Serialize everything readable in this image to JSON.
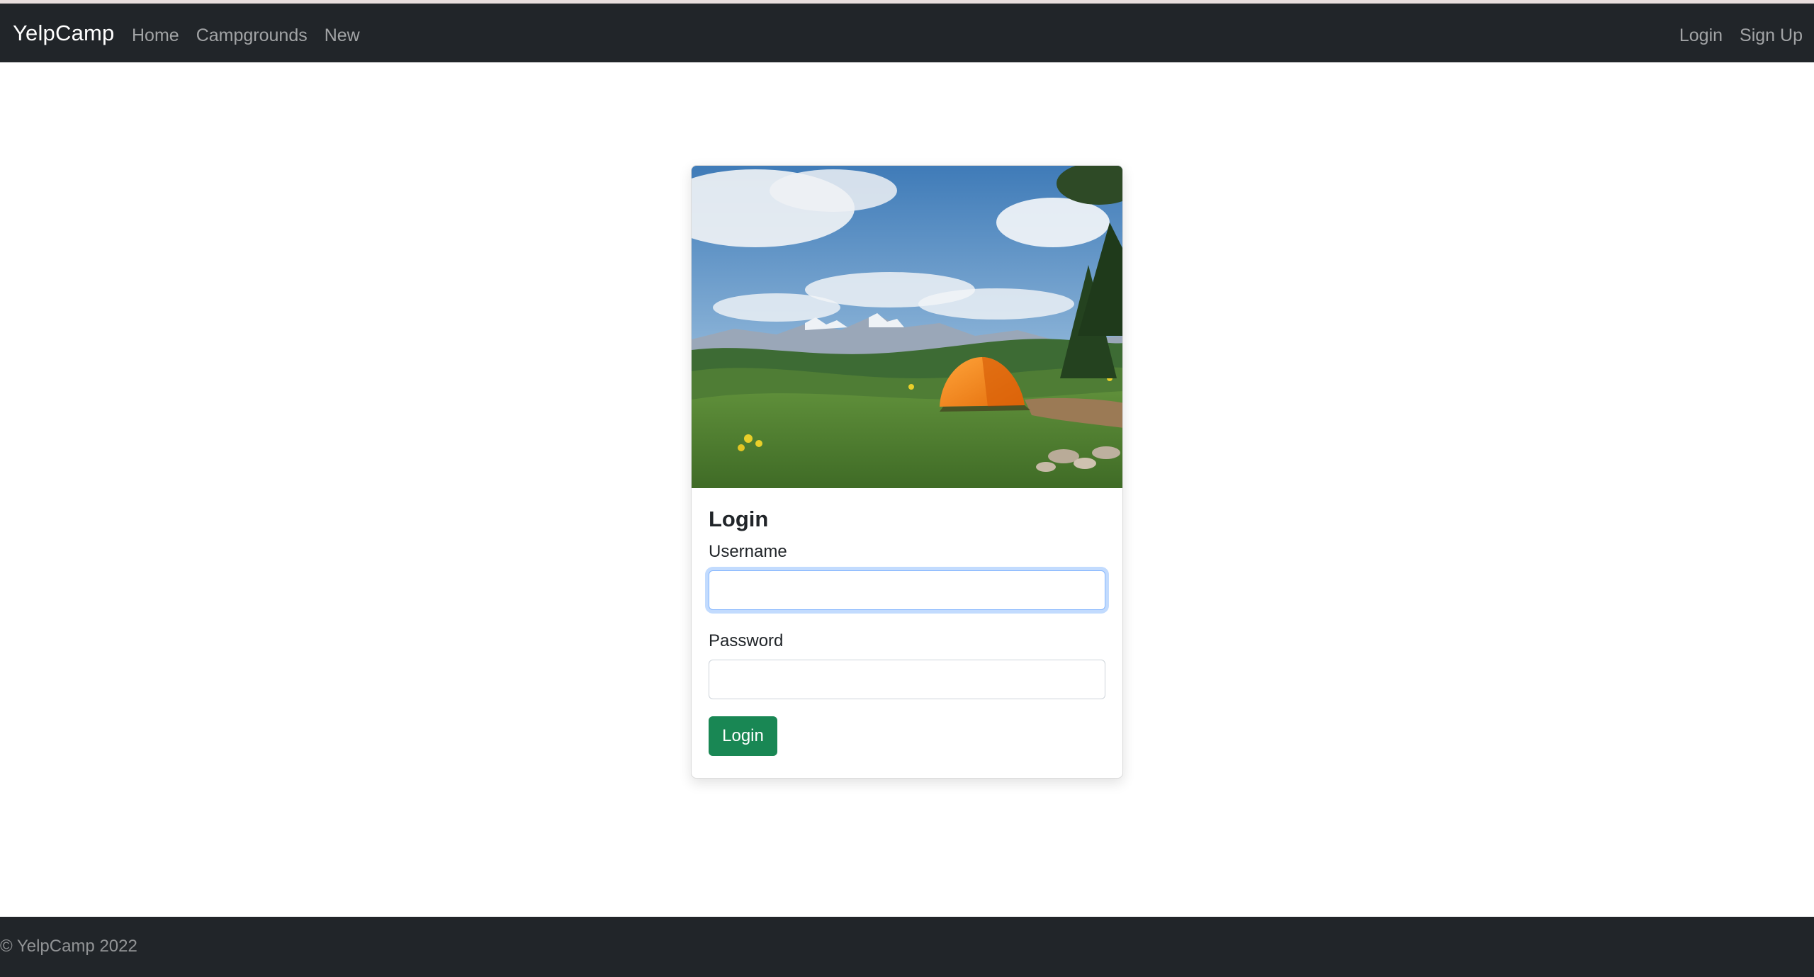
{
  "navbar": {
    "brand": "YelpCamp",
    "left_links": [
      "Home",
      "Campgrounds",
      "New"
    ],
    "right_links": [
      "Login",
      "Sign Up"
    ]
  },
  "login_card": {
    "title": "Login",
    "username_label": "Username",
    "username_value": "",
    "password_label": "Password",
    "password_value": "",
    "submit_label": "Login"
  },
  "footer": {
    "text": "© YelpCamp 2022"
  },
  "colors": {
    "navbar_bg": "#212529",
    "primary_button": "#198754",
    "focus_ring": "#86b7fe"
  }
}
